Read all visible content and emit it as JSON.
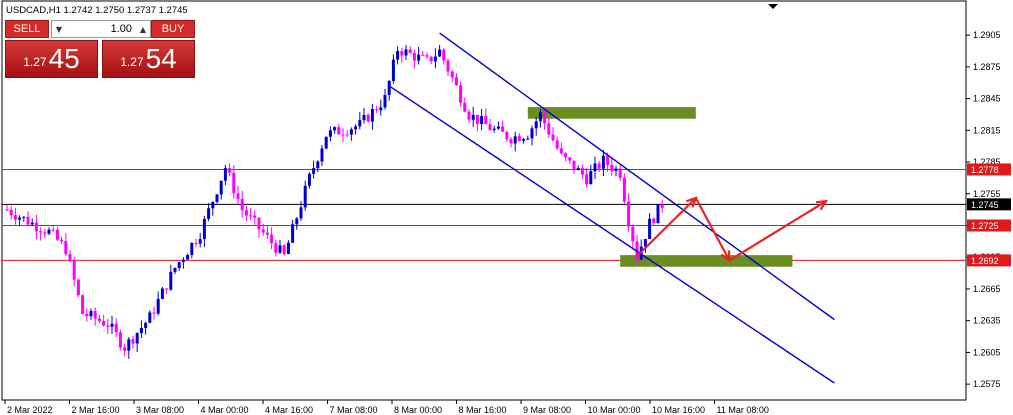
{
  "header": {
    "ticker_line": "USDCAD,H1  1.2742 1.2750 1.2737 1.2745"
  },
  "trade_panel": {
    "sell_label": "SELL",
    "buy_label": "BUY",
    "lot_value": "1.00",
    "sell_price_prefix": "1.27",
    "sell_price_big": "45",
    "buy_price_prefix": "1.27",
    "buy_price_big": "54"
  },
  "colors": {
    "bull_candle": "#0000cc",
    "bear_candle": "#ff00ff",
    "channel": "#0000cc",
    "hline": "#e0191b",
    "price_line": "#000000",
    "zone": "#6b8e23",
    "forecast": "#ee2222"
  },
  "chart_data": {
    "type": "candlestick",
    "symbol": "USDCAD",
    "timeframe": "H1",
    "ylim": [
      1.256,
      1.2925
    ],
    "y_ticks": [
      "1.2905",
      "1.2875",
      "1.2845",
      "1.2815",
      "1.2785",
      "1.2755",
      "1.2725",
      "1.2695",
      "1.2665",
      "1.2635",
      "1.2605",
      "1.2575"
    ],
    "x_ticks": [
      "2 Mar 2022",
      "2 Mar 16:00",
      "3 Mar 08:00",
      "4 Mar 00:00",
      "4 Mar 16:00",
      "7 Mar 08:00",
      "8 Mar 00:00",
      "8 Mar 16:00",
      "9 Mar 08:00",
      "10 Mar 00:00",
      "10 Mar 16:00",
      "11 Mar 08:00"
    ],
    "bars_total": 188,
    "current_price": {
      "value": 1.2745,
      "label": "1.2745"
    },
    "horizontal_levels": [
      {
        "value": 1.2778,
        "label": "1.2778"
      },
      {
        "value": 1.2725,
        "label": "1.2725"
      },
      {
        "value": 1.2692,
        "label": "1.2692"
      }
    ],
    "zones": [
      {
        "bar_start": 124,
        "bar_end": 164,
        "low": 1.2826,
        "high": 1.2837
      },
      {
        "bar_start": 146,
        "bar_end": 187,
        "low": 1.2686,
        "high": 1.2697
      }
    ],
    "channel_lines": [
      {
        "bar_start": 103,
        "price_start": 1.2907,
        "bar_end": 197,
        "price_end": 1.2636
      },
      {
        "bar_start": 91,
        "price_start": 1.2857,
        "bar_end": 197,
        "price_end": 1.2576
      }
    ],
    "forecast_path": [
      {
        "bar": 150,
        "price": 1.2696
      },
      {
        "bar": 164,
        "price": 1.2751
      },
      {
        "bar": 172,
        "price": 1.2692
      },
      {
        "bar": 195,
        "price": 1.2748
      }
    ],
    "close_path": [
      {
        "bar": 0,
        "price": 1.274
      },
      {
        "bar": 6,
        "price": 1.2727
      },
      {
        "bar": 10,
        "price": 1.2719
      },
      {
        "bar": 14,
        "price": 1.2703
      },
      {
        "bar": 18,
        "price": 1.2642
      },
      {
        "bar": 24,
        "price": 1.2632
      },
      {
        "bar": 28,
        "price": 1.261
      },
      {
        "bar": 34,
        "price": 1.2638
      },
      {
        "bar": 40,
        "price": 1.2685
      },
      {
        "bar": 46,
        "price": 1.2718
      },
      {
        "bar": 52,
        "price": 1.278
      },
      {
        "bar": 56,
        "price": 1.274
      },
      {
        "bar": 60,
        "price": 1.2722
      },
      {
        "bar": 66,
        "price": 1.2696
      },
      {
        "bar": 72,
        "price": 1.277
      },
      {
        "bar": 76,
        "price": 1.2811
      },
      {
        "bar": 84,
        "price": 1.282
      },
      {
        "bar": 90,
        "price": 1.2845
      },
      {
        "bar": 93,
        "price": 1.2892
      },
      {
        "bar": 100,
        "price": 1.288
      },
      {
        "bar": 103,
        "price": 1.289
      },
      {
        "bar": 110,
        "price": 1.283
      },
      {
        "bar": 116,
        "price": 1.2815
      },
      {
        "bar": 120,
        "price": 1.2808
      },
      {
        "bar": 124,
        "price": 1.2812
      },
      {
        "bar": 127,
        "price": 1.283
      },
      {
        "bar": 132,
        "price": 1.279
      },
      {
        "bar": 138,
        "price": 1.277
      },
      {
        "bar": 142,
        "price": 1.2786
      },
      {
        "bar": 146,
        "price": 1.2775
      },
      {
        "bar": 148,
        "price": 1.273
      },
      {
        "bar": 150,
        "price": 1.2696
      },
      {
        "bar": 153,
        "price": 1.2727
      },
      {
        "bar": 156,
        "price": 1.2745
      }
    ]
  }
}
